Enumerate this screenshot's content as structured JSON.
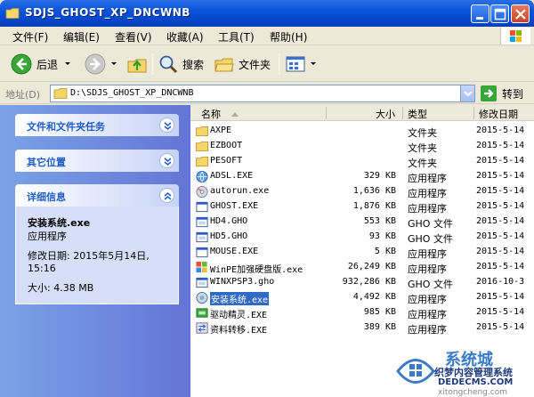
{
  "window": {
    "title": "SDJS_GHOST_XP_DNCWNB"
  },
  "menu": {
    "items": [
      "文件(F)",
      "编辑(E)",
      "查看(V)",
      "收藏(A)",
      "工具(T)",
      "帮助(H)"
    ]
  },
  "toolbar": {
    "back_label": "后退",
    "search_label": "搜索",
    "folders_label": "文件夹"
  },
  "address": {
    "label": "地址(D)",
    "value": "D:\\SDJS_GHOST_XP_DNCWNB",
    "go_label": "转到"
  },
  "left_pane": {
    "tasks_title": "文件和文件夹任务",
    "places_title": "其它位置",
    "details_title": "详细信息",
    "details": {
      "file_name": "安装系统.exe",
      "file_type": "应用程序",
      "modified_label": "修改日期:",
      "modified_value": "2015年5月14日, 15:16",
      "size_label": "大小:",
      "size_value": "4.38 MB"
    }
  },
  "columns": {
    "name": "名称",
    "size": "大小",
    "type": "类型",
    "modified": "修改日期"
  },
  "files": [
    {
      "name": "AXPE",
      "size": "",
      "type": "文件夹",
      "date": "2015-5-14",
      "icon": "folder-icon"
    },
    {
      "name": "EZBOOT",
      "size": "",
      "type": "文件夹",
      "date": "2015-5-14",
      "icon": "folder-icon"
    },
    {
      "name": "PESOFT",
      "size": "",
      "type": "文件夹",
      "date": "2015-5-14",
      "icon": "folder-icon"
    },
    {
      "name": "ADSL.EXE",
      "size": "329 KB",
      "type": "应用程序",
      "date": "2015-5-14",
      "icon": "globe-app-icon"
    },
    {
      "name": "autorun.exe",
      "size": "1,636 KB",
      "type": "应用程序",
      "date": "2015-5-14",
      "icon": "cd-app-icon"
    },
    {
      "name": "GHOST.EXE",
      "size": "1,876 KB",
      "type": "应用程序",
      "date": "2015-5-14",
      "icon": "window-app-icon"
    },
    {
      "name": "HD4.GHO",
      "size": "553 KB",
      "type": "GHO 文件",
      "date": "2015-5-14",
      "icon": "gho-file-icon"
    },
    {
      "name": "HD5.GHO",
      "size": "93 KB",
      "type": "GHO 文件",
      "date": "2015-5-14",
      "icon": "gho-file-icon"
    },
    {
      "name": "MOUSE.EXE",
      "size": "5 KB",
      "type": "应用程序",
      "date": "2015-5-14",
      "icon": "window-app-icon"
    },
    {
      "name": "WinPE加强硬盘版.exe",
      "size": "26,249 KB",
      "type": "应用程序",
      "date": "2015-5-14",
      "icon": "winpe-app-icon"
    },
    {
      "name": "WINXPSP3.gho",
      "size": "932,286 KB",
      "type": "GHO 文件",
      "date": "2016-10-3",
      "icon": "gho-file-icon"
    },
    {
      "name": "安装系统.exe",
      "size": "4,492 KB",
      "type": "应用程序",
      "date": "2015-5-14",
      "icon": "setup-app-icon",
      "selected": true
    },
    {
      "name": "驱动精灵.EXE",
      "size": "985 KB",
      "type": "应用程序",
      "date": "2015-5-14",
      "icon": "driver-app-icon"
    },
    {
      "name": "资料转移.EXE",
      "size": "389 KB",
      "type": "应用程序",
      "date": "2015-5-14",
      "icon": "transfer-app-icon"
    }
  ],
  "watermark": {
    "title": "系统城",
    "subtitle": "织梦内容管理系统",
    "url": "DEDECMS.COM",
    "url2": "xitongcheng.com"
  },
  "colors": {
    "titlebar": "#0a54dc",
    "selection": "#316ac5",
    "panel_title": "#215dc6"
  }
}
